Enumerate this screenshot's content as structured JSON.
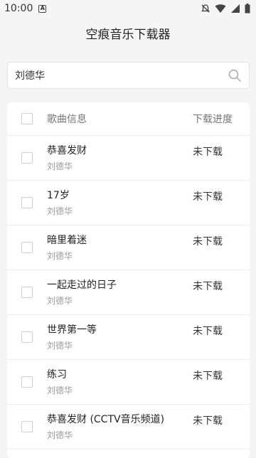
{
  "status_bar": {
    "time": "10:00",
    "notif_badge": "A"
  },
  "app": {
    "title": "空痕音乐下载器"
  },
  "search": {
    "value": "刘德华"
  },
  "table": {
    "headers": {
      "info": "歌曲信息",
      "status": "下载进度"
    },
    "rows": [
      {
        "title": "恭喜发财",
        "artist": "刘德华",
        "status": "未下载"
      },
      {
        "title": "17岁",
        "artist": "刘德华",
        "status": "未下载"
      },
      {
        "title": "暗里着迷",
        "artist": "刘德华",
        "status": "未下载"
      },
      {
        "title": "一起走过的日子",
        "artist": "刘德华",
        "status": "未下载"
      },
      {
        "title": "世界第一等",
        "artist": "刘德华",
        "status": "未下载"
      },
      {
        "title": "练习",
        "artist": "刘德华",
        "status": "未下载"
      },
      {
        "title": "恭喜发财 (CCTV音乐频道)",
        "artist": "刘德华",
        "status": "未下载"
      }
    ]
  }
}
